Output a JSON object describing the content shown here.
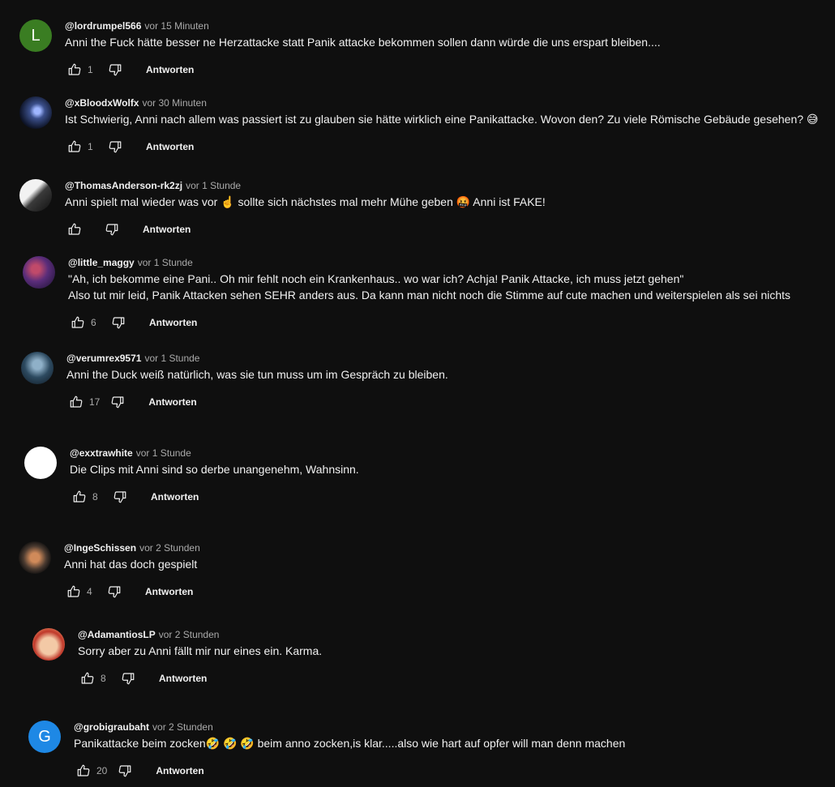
{
  "comments": [
    {
      "author": "@lordrumpel566",
      "time": "vor 15 Minuten",
      "text": "Anni the Fuck hätte besser ne Herzattacke statt Panik attacke bekommen sollen dann würde die uns erspart bleiben....",
      "likes": "1",
      "reply": "Antworten",
      "avatar_letter": "L",
      "avatar_color": "#3a7d22"
    },
    {
      "author": "@xBloodxWolfx",
      "time": "vor 30 Minuten",
      "text": "Ist Schwierig, Anni nach allem was passiert ist zu glauben sie hätte wirklich eine Panikattacke. Wovon den? Zu viele Römische Gebäude gesehen? 😅",
      "likes": "1",
      "reply": "Antworten",
      "avatar_letter": "",
      "avatar_color": "#1b2a4a"
    },
    {
      "author": "@ThomasAnderson-rk2zj",
      "time": "vor 1 Stunde",
      "text": "Anni spielt mal wieder was vor ☝️ sollte sich nächstes mal mehr Mühe geben 🤬 Anni ist FAKE!",
      "likes": "",
      "reply": "Antworten",
      "avatar_letter": "",
      "avatar_color": "#e8e8e8"
    },
    {
      "author": "@little_maggy",
      "time": "vor 1 Stunde",
      "text": "\"Ah, ich bekomme eine Pani.. Oh mir fehlt noch ein Krankenhaus.. wo war ich? Achja! Panik Attacke, ich muss jetzt gehen\"\nAlso tut mir leid, Panik Attacken sehen SEHR anders aus. Da kann man nicht noch die Stimme auf cute machen und weiterspielen als sei nichts",
      "likes": "6",
      "reply": "Antworten",
      "avatar_letter": "",
      "avatar_color": "#4a2a55"
    },
    {
      "author": "@verumrex9571",
      "time": "vor 1 Stunde",
      "text": "Anni the Duck weiß natürlich, was sie tun muss um im Gespräch zu bleiben.",
      "likes": "17",
      "reply": "Antworten",
      "avatar_letter": "",
      "avatar_color": "#24384a"
    },
    {
      "author": "@exxtrawhite",
      "time": "vor 1 Stunde",
      "text": "Die Clips mit Anni sind so derbe unangenehm, Wahnsinn.",
      "likes": "8",
      "reply": "Antworten",
      "avatar_letter": "",
      "avatar_color": "#ffffff"
    },
    {
      "author": "@IngeSchissen",
      "time": "vor 2 Stunden",
      "text": "Anni hat das doch gespielt",
      "likes": "4",
      "reply": "Antworten",
      "avatar_letter": "",
      "avatar_color": "#3b2f28"
    },
    {
      "author": "@AdamantiosLP",
      "time": "vor 2 Stunden",
      "text": "Sorry aber zu Anni fällt mir nur eines ein. Karma.",
      "likes": "8",
      "reply": "Antworten",
      "avatar_letter": "",
      "avatar_color": "#f0b07a"
    },
    {
      "author": "@grobigraubaht",
      "time": "vor 2 Stunden",
      "text": "Panikattacke beim zocken🤣 🤣 🤣 beim anno zocken,is klar.....also wie hart auf opfer will man denn machen",
      "likes": "20",
      "reply": "Antworten",
      "avatar_letter": "G",
      "avatar_color": "#1e88e5"
    }
  ]
}
